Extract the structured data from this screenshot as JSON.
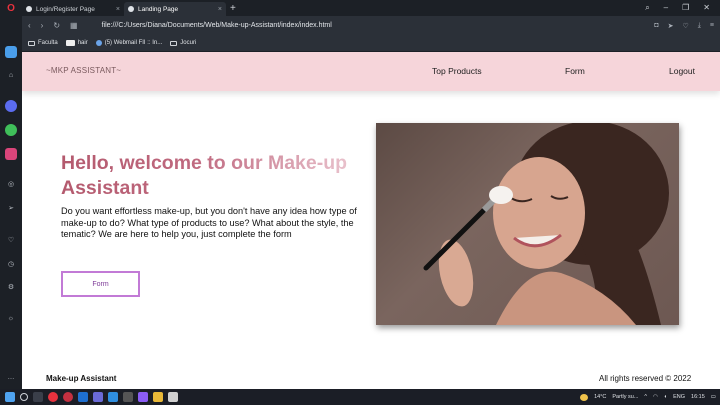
{
  "tabs": [
    {
      "label": "Login/Register Page",
      "active": false
    },
    {
      "label": "Landing Page",
      "active": true
    }
  ],
  "address": {
    "url": "file:///C:/Users/Diana/Documents/Web/Make-up-Assistant/index/index.html"
  },
  "bookmarks": [
    {
      "label": "Faculta",
      "icon": "folder-icon"
    },
    {
      "label": "hair",
      "icon": "image-icon"
    },
    {
      "label": "(5) Webmail FII :: In...",
      "icon": "globe-icon"
    },
    {
      "label": "Jocuri",
      "icon": "folder-icon"
    }
  ],
  "page": {
    "brand": "~MKP ASSISTANT~",
    "nav": [
      "Top Products",
      "Form",
      "Logout"
    ],
    "headline": "Hello, welcome to our Make-up Assistant",
    "intro": "Do you want effortless make-up, but you don't have any idea how type of make-up to do? What type of products to use? What about the style, the tematic? We are here to help you, just complete the form",
    "form_button": "Form",
    "footer_brand": "Make-up Assistant",
    "footer_copy": "All rights reserved © 2022"
  },
  "taskbar": {
    "weather_temp": "14°C",
    "weather_text": "Partly su...",
    "lang": "ENG",
    "time": "16:15"
  },
  "colors": {
    "nav_bg": "#f6d5da",
    "headline_start": "#b45a6e",
    "headline_end": "#ecc8d2",
    "button_border": "#c27ad6",
    "opera_red": "#e8323e"
  }
}
